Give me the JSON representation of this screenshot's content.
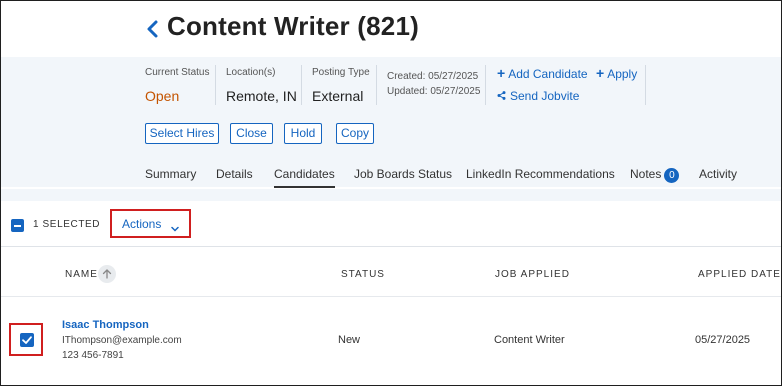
{
  "header": {
    "title": "Content Writer (821)"
  },
  "info": {
    "status_label": "Current Status",
    "status_value": "Open",
    "location_label": "Location(s)",
    "location_value": "Remote, IN",
    "posting_label": "Posting Type",
    "posting_value": "External",
    "created": "Created: 05/27/2025",
    "updated": "Updated: 05/27/2025",
    "add_candidate": "Add Candidate",
    "apply": "Apply",
    "send_jobvite": "Send Jobvite"
  },
  "buttons": {
    "select_hires": "Select Hires",
    "close": "Close",
    "hold": "Hold",
    "copy": "Copy"
  },
  "tabs": [
    {
      "label": "Summary"
    },
    {
      "label": "Details"
    },
    {
      "label": "Candidates"
    },
    {
      "label": "Job Boards Status"
    },
    {
      "label": "LinkedIn Recommendations"
    },
    {
      "label": "Notes"
    },
    {
      "label": "Activity"
    }
  ],
  "notes_count": "0",
  "active_tab": "Candidates",
  "selection": {
    "count_text": "1 SELECTED",
    "actions_label": "Actions"
  },
  "table": {
    "columns": [
      "NAME",
      "STATUS",
      "JOB APPLIED",
      "APPLIED DATE"
    ],
    "rows": [
      {
        "name": "Isaac Thompson",
        "email": "IThompson@example.com",
        "phone": "123 456-7891",
        "status": "New",
        "job_applied": "Content Writer",
        "applied_date": "05/27/2025",
        "checked": true
      }
    ]
  },
  "colors": {
    "accent": "#1565c0",
    "status_open": "#c45400",
    "highlight": "#d01f1f",
    "panel_bg": "#f2f6fa"
  }
}
